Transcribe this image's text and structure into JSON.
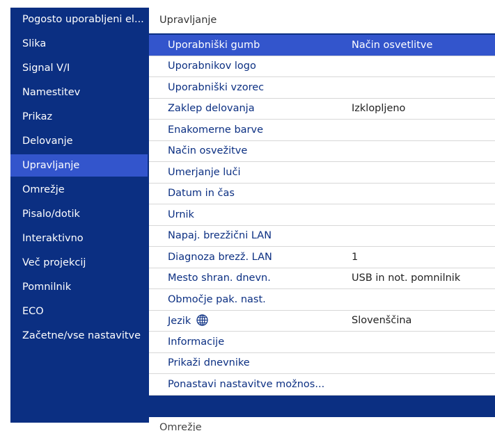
{
  "sidebar": {
    "items": [
      "Pogosto uporabljeni el...",
      "Slika",
      "Signal V/I",
      "Namestitev",
      "Prikaz",
      "Delovanje",
      "Upravljanje",
      "Omrežje",
      "Pisalo/dotik",
      "Interaktivno",
      "Več projekcij",
      "Pomnilnik",
      "ECO",
      "Začetne/vse nastavitve"
    ],
    "active_index": 6
  },
  "panel": {
    "title": "Upravljanje",
    "next_title": "Omrežje",
    "selected_index": 0,
    "rows": [
      {
        "label": "Uporabniški gumb",
        "value": "Način osvetlitve"
      },
      {
        "label": "Uporabnikov logo",
        "value": ""
      },
      {
        "label": "Uporabniški vzorec",
        "value": ""
      },
      {
        "label": "Zaklep delovanja",
        "value": "Izklopljeno"
      },
      {
        "label": "Enakomerne barve",
        "value": ""
      },
      {
        "label": "Način osvežitve",
        "value": ""
      },
      {
        "label": "Umerjanje luči",
        "value": ""
      },
      {
        "label": "Datum in čas",
        "value": ""
      },
      {
        "label": "Urnik",
        "value": ""
      },
      {
        "label": "Napaj. brezžični LAN",
        "value": ""
      },
      {
        "label": "Diagnoza brezž. LAN",
        "value": "1"
      },
      {
        "label": "Mesto shran. dnevn.",
        "value": "USB in not. pomnilnik"
      },
      {
        "label": "Območje pak. nast.",
        "value": ""
      },
      {
        "label": "Jezik",
        "value": "Slovenščina",
        "icon": "globe-icon"
      },
      {
        "label": "Informacije",
        "value": ""
      },
      {
        "label": "Prikaži dnevnike",
        "value": ""
      },
      {
        "label": "Ponastavi nastavitve možnos...",
        "value": ""
      }
    ]
  },
  "colors": {
    "background_navy": "#0b2f82",
    "highlight_blue": "#3355cc",
    "panel_white": "#ffffff"
  }
}
